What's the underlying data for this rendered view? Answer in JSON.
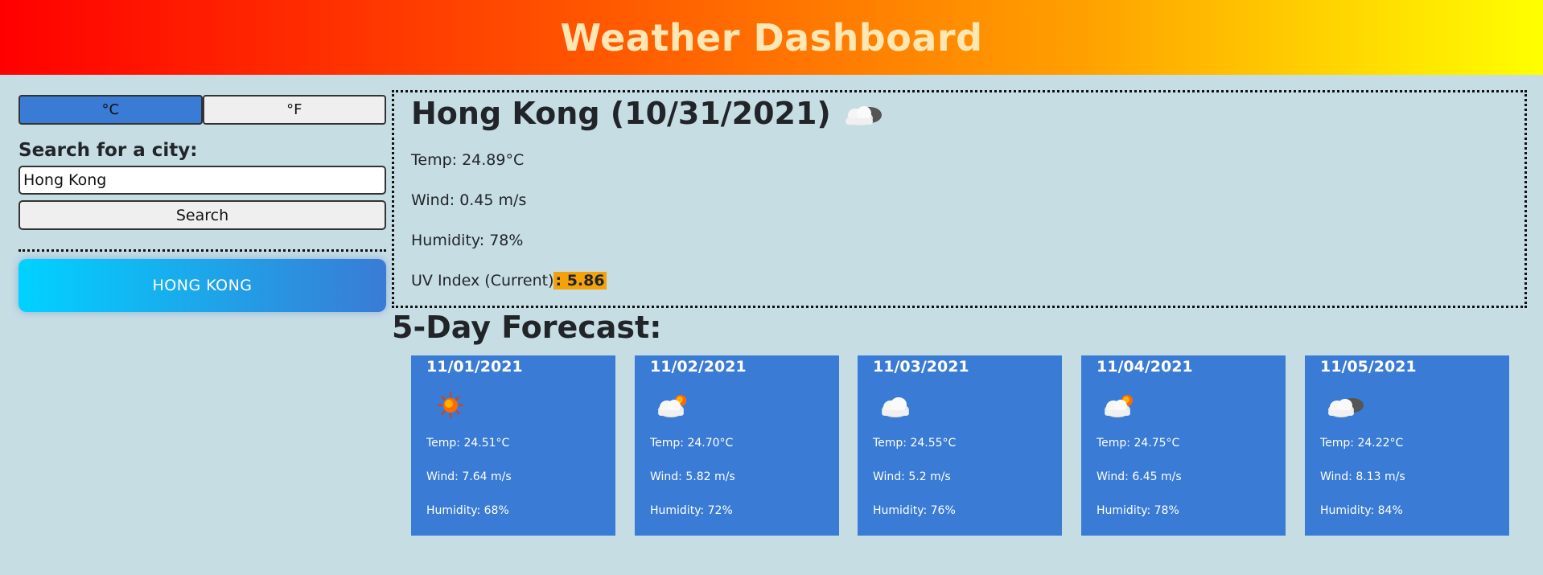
{
  "header": {
    "title": "Weather Dashboard"
  },
  "units": {
    "celsius_label": "°C",
    "fahrenheit_label": "°F",
    "selected": "°C"
  },
  "search": {
    "label": "Search for a city:",
    "value": "Hong Kong",
    "button_label": "Search"
  },
  "history": [
    {
      "label": "HONG KONG"
    }
  ],
  "current": {
    "title": "Hong Kong (10/31/2021)",
    "icon": "cloud-icon",
    "temp": "Temp: 24.89°C",
    "wind": "Wind: 0.45 m/s",
    "humidity": "Humidity: 78%",
    "uv_label": "UV Index (Current)",
    "uv_value": ": 5.86",
    "uv_color": "#f5a20a"
  },
  "forecast": {
    "title": "5-Day Forecast:",
    "card_color": "#3a7bd5",
    "days": [
      {
        "date": "11/01/2021",
        "icon": "sun-icon",
        "temp": "Temp: 24.51°C",
        "wind": "Wind: 7.64 m/s",
        "humidity": "Humidity: 68%"
      },
      {
        "date": "11/02/2021",
        "icon": "partly-cloudy-icon",
        "temp": "Temp: 24.70°C",
        "wind": "Wind: 5.82 m/s",
        "humidity": "Humidity: 72%"
      },
      {
        "date": "11/03/2021",
        "icon": "cloud-icon",
        "temp": "Temp: 24.55°C",
        "wind": "Wind: 5.2 m/s",
        "humidity": "Humidity: 76%"
      },
      {
        "date": "11/04/2021",
        "icon": "partly-cloudy-icon",
        "temp": "Temp: 24.75°C",
        "wind": "Wind: 6.45 m/s",
        "humidity": "Humidity: 78%"
      },
      {
        "date": "11/05/2021",
        "icon": "broken-clouds-icon",
        "temp": "Temp: 24.22°C",
        "wind": "Wind: 8.13 m/s",
        "humidity": "Humidity: 84%"
      }
    ]
  }
}
